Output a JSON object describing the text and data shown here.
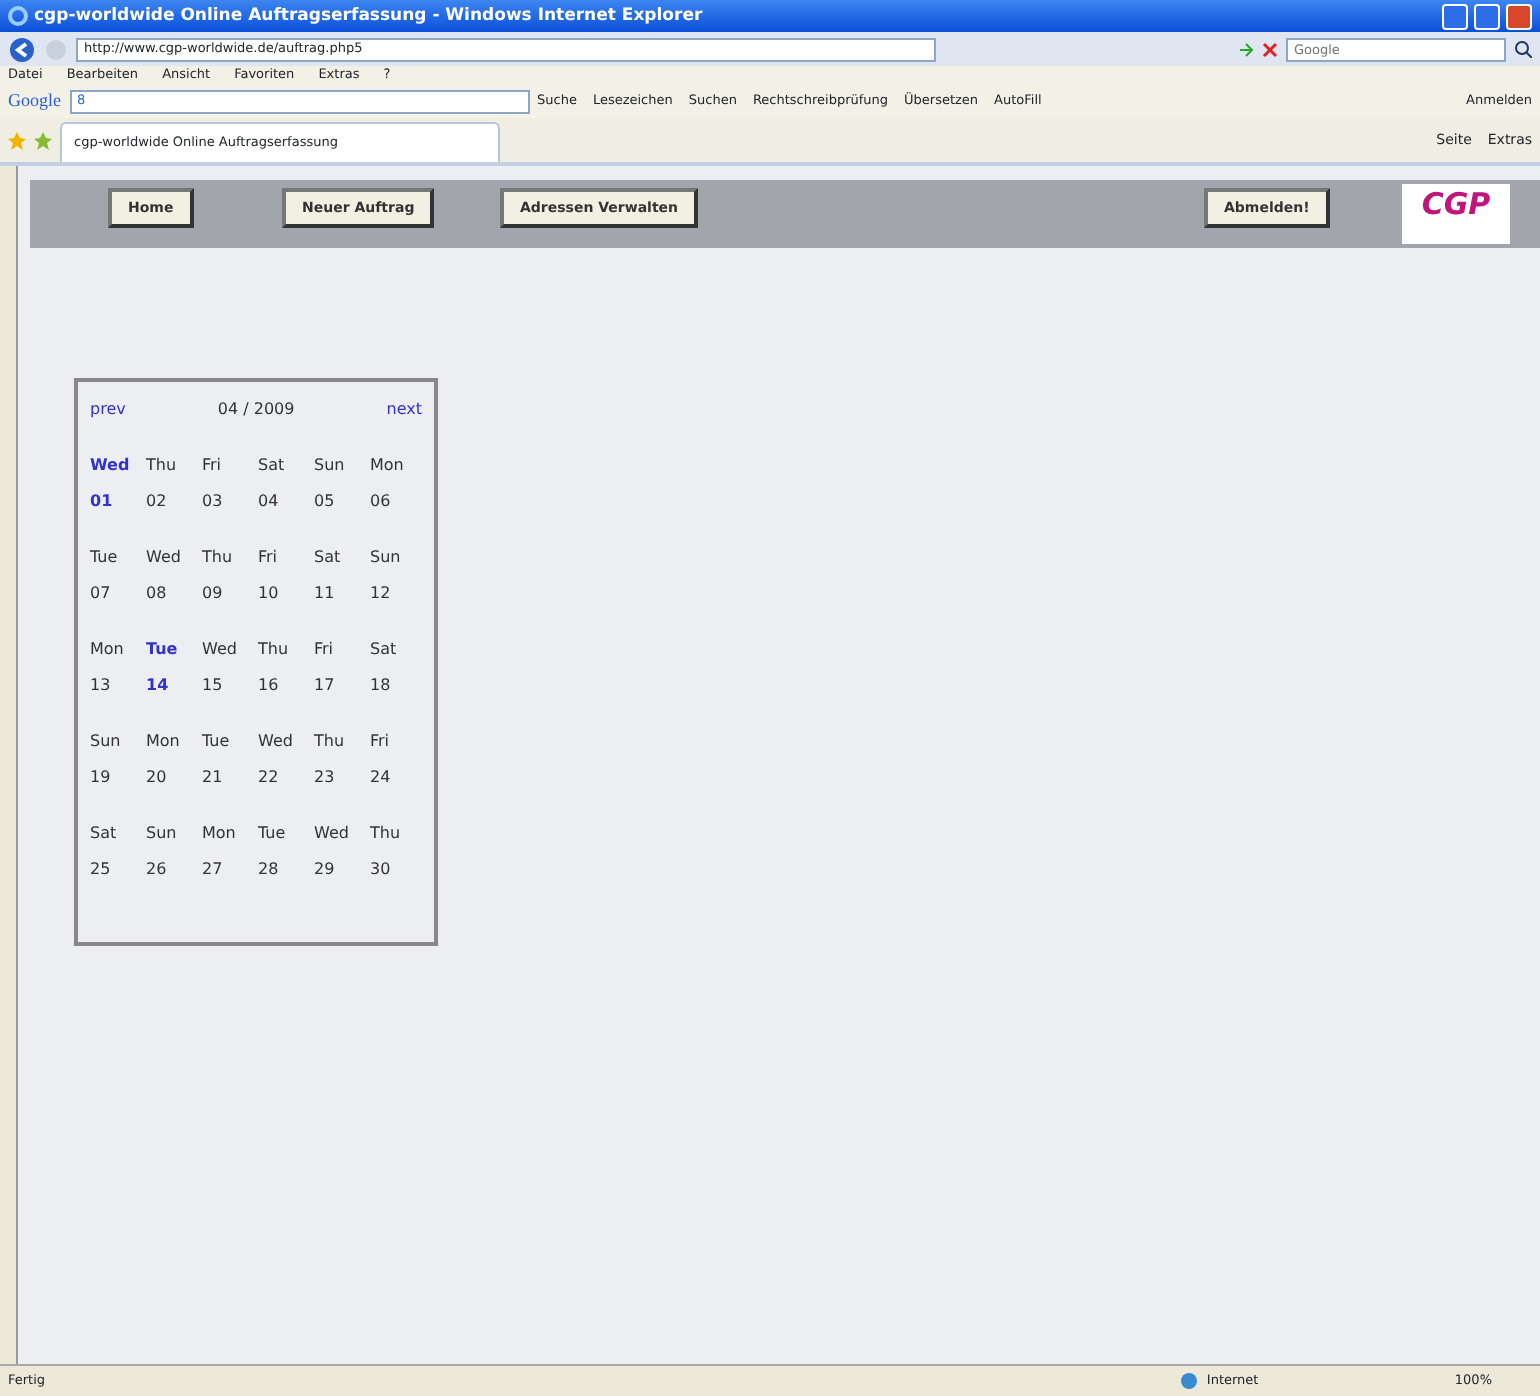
{
  "window": {
    "title": "cgp-worldwide Online Auftragserfassung - Windows Internet Explorer"
  },
  "address_bar": {
    "url": "http://www.cgp-worldwide.de/auftrag.php5",
    "search_placeholder": "Google"
  },
  "menu": [
    "Datei",
    "Bearbeiten",
    "Ansicht",
    "Favoriten",
    "Extras",
    "?"
  ],
  "google_toolbar": {
    "logo": "Google",
    "search_value": "8",
    "items": [
      "Suche",
      "Lesezeichen",
      "Suchen",
      "Rechtschreibprüfung",
      "Übersetzen",
      "AutoFill"
    ],
    "signin": "Anmelden"
  },
  "tab": {
    "title": "cgp-worldwide Online Auftragserfassung"
  },
  "command_bar": [
    "Seite",
    "Extras"
  ],
  "nav": {
    "buttons": [
      "Home",
      "Neuer Auftrag",
      "Adressen Verwalten"
    ],
    "logout": "Abmelden!",
    "logo": "CGP"
  },
  "calendar": {
    "prev": "prev",
    "month": "04 / 2009",
    "next": "next",
    "weeks": [
      [
        {
          "dow": "Wed",
          "day": "01",
          "highlighted": true
        },
        {
          "dow": "Thu",
          "day": "02",
          "highlighted": false
        },
        {
          "dow": "Fri",
          "day": "03",
          "highlighted": false
        },
        {
          "dow": "Sat",
          "day": "04",
          "highlighted": false
        },
        {
          "dow": "Sun",
          "day": "05",
          "highlighted": false
        },
        {
          "dow": "Mon",
          "day": "06",
          "highlighted": false
        }
      ],
      [
        {
          "dow": "Tue",
          "day": "07",
          "highlighted": false
        },
        {
          "dow": "Wed",
          "day": "08",
          "highlighted": false
        },
        {
          "dow": "Thu",
          "day": "09",
          "highlighted": false
        },
        {
          "dow": "Fri",
          "day": "10",
          "highlighted": false
        },
        {
          "dow": "Sat",
          "day": "11",
          "highlighted": false
        },
        {
          "dow": "Sun",
          "day": "12",
          "highlighted": false
        }
      ],
      [
        {
          "dow": "Mon",
          "day": "13",
          "highlighted": false
        },
        {
          "dow": "Tue",
          "day": "14",
          "highlighted": true
        },
        {
          "dow": "Wed",
          "day": "15",
          "highlighted": false
        },
        {
          "dow": "Thu",
          "day": "16",
          "highlighted": false
        },
        {
          "dow": "Fri",
          "day": "17",
          "highlighted": false
        },
        {
          "dow": "Sat",
          "day": "18",
          "highlighted": false
        }
      ],
      [
        {
          "dow": "Sun",
          "day": "19",
          "highlighted": false
        },
        {
          "dow": "Mon",
          "day": "20",
          "highlighted": false
        },
        {
          "dow": "Tue",
          "day": "21",
          "highlighted": false
        },
        {
          "dow": "Wed",
          "day": "22",
          "highlighted": false
        },
        {
          "dow": "Thu",
          "day": "23",
          "highlighted": false
        },
        {
          "dow": "Fri",
          "day": "24",
          "highlighted": false
        }
      ],
      [
        {
          "dow": "Sat",
          "day": "25",
          "highlighted": false
        },
        {
          "dow": "Sun",
          "day": "26",
          "highlighted": false
        },
        {
          "dow": "Mon",
          "day": "27",
          "highlighted": false
        },
        {
          "dow": "Tue",
          "day": "28",
          "highlighted": false
        },
        {
          "dow": "Wed",
          "day": "29",
          "highlighted": false
        },
        {
          "dow": "Thu",
          "day": "30",
          "highlighted": false
        }
      ]
    ]
  },
  "status_bar": {
    "status": "Fertig",
    "zone": "Internet",
    "zoom": "100%"
  }
}
